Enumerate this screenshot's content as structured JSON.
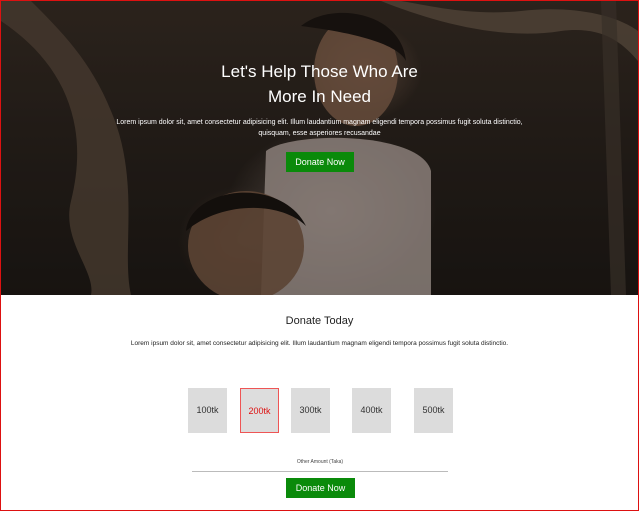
{
  "hero": {
    "title_line1": "Let's Help Those Who Are",
    "title_line2": "More In Need",
    "text": "Lorem ipsum dolor sit, amet consectetur adipisicing elit. Illum laudantium magnam eligendi tempora possimus fugit soluta distinctio, quisquam, esse asperiores recusandae",
    "button_label": "Donate Now"
  },
  "donate": {
    "title": "Donate Today",
    "text": "Lorem ipsum dolor sit, amet consectetur adipisicing elit. Illum laudantium magnam eligendi tempora possimus fugit soluta distinctio.",
    "amounts": [
      "100tk",
      "200tk",
      "300tk",
      "400tk",
      "500tk"
    ],
    "selected_amount": "200tk",
    "other_label": "Other Amount (Taka)",
    "button_label": "Donate Now"
  },
  "colors": {
    "accent_green": "#0a8a0a",
    "selected_red": "#dd1111"
  }
}
